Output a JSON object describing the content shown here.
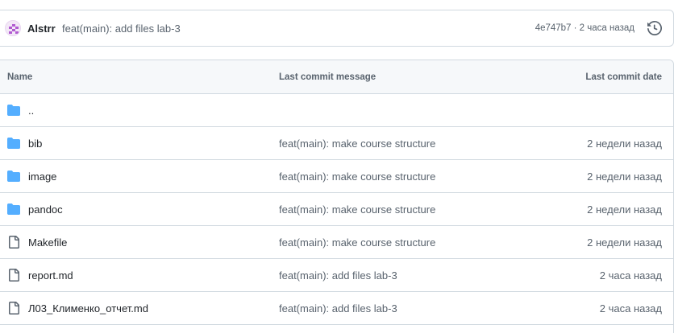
{
  "commit": {
    "author": "Alstrr",
    "message": "feat(main): add files lab-3",
    "meta": "4e747b7 · 2 часа назад",
    "avatar_color": "#b15bd1"
  },
  "table": {
    "headers": {
      "name": "Name",
      "message": "Last commit message",
      "date": "Last commit date"
    },
    "rows": [
      {
        "name": "..",
        "type": "folder",
        "message": "",
        "date": ""
      },
      {
        "name": "bib",
        "type": "folder",
        "message": "feat(main): make course structure",
        "date": "2 недели назад"
      },
      {
        "name": "image",
        "type": "folder",
        "message": "feat(main): make course structure",
        "date": "2 недели назад"
      },
      {
        "name": "pandoc",
        "type": "folder",
        "message": "feat(main): make course structure",
        "date": "2 недели назад"
      },
      {
        "name": "Makefile",
        "type": "file",
        "message": "feat(main): make course structure",
        "date": "2 недели назад"
      },
      {
        "name": "report.md",
        "type": "file",
        "message": "feat(main): add files lab-3",
        "date": "2 часа назад"
      },
      {
        "name": "Л03_Клименко_отчет.md",
        "type": "file",
        "message": "feat(main): add files lab-3",
        "date": "2 часа назад"
      }
    ]
  },
  "colors": {
    "folder": "#54aeff",
    "file": "#59636e",
    "border": "#d1d9e0",
    "header_bg": "#f6f8fa"
  },
  "icons": {
    "folder": "folder-icon",
    "file": "file-icon",
    "history": "history-icon"
  }
}
